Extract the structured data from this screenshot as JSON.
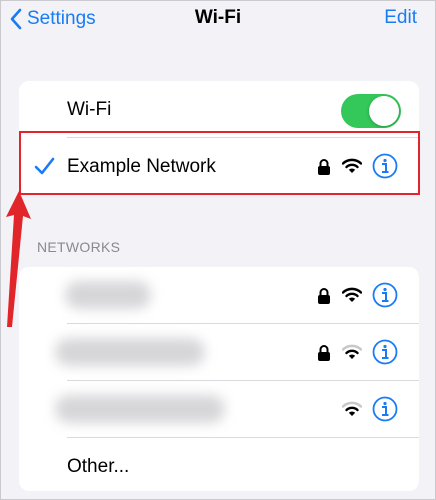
{
  "nav": {
    "back_label": "Settings",
    "title": "Wi-Fi",
    "edit_label": "Edit"
  },
  "wifi_toggle": {
    "label": "Wi-Fi",
    "on": true
  },
  "connected_network": {
    "name": "Example Network",
    "checked": true,
    "secured": true,
    "signal": "full"
  },
  "networks": {
    "header": "NETWORKS",
    "items": [
      {
        "name": "",
        "secured": true,
        "signal": "full"
      },
      {
        "name": "",
        "secured": true,
        "signal": "medium"
      },
      {
        "name": "",
        "secured": false,
        "signal": "medium"
      }
    ],
    "other_label": "Other..."
  },
  "colors": {
    "accent": "#1a7cf5",
    "toggle_on": "#34c759",
    "annotation": "#e0262b",
    "background": "#f2f2f7"
  },
  "icons": [
    "chevron-left-icon",
    "checkmark-icon",
    "lock-icon",
    "wifi-icon",
    "info-icon",
    "arrow-annotation"
  ]
}
